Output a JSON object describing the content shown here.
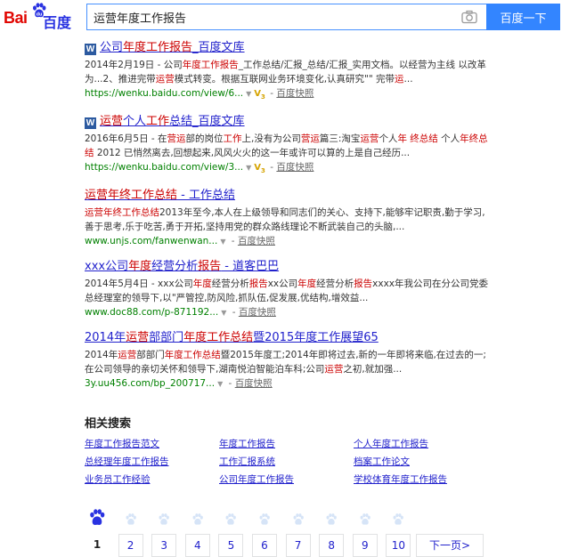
{
  "header": {
    "logo_bai": "Bai",
    "logo_du": "百度",
    "search_value": "运营年度工作报告",
    "search_button": "百度一下"
  },
  "results": [
    {
      "has_word_icon": true,
      "title_parts": [
        {
          "t": "公司",
          "hl": false
        },
        {
          "t": "年度工作报告",
          "hl": true
        },
        {
          "t": "_百度文库",
          "hl": false
        }
      ],
      "abstract_parts": [
        {
          "t": "2014年2月19日 - 公司",
          "hl": false
        },
        {
          "t": "年度工作报告",
          "hl": true
        },
        {
          "t": "_工作总结/汇报_总结/汇报_实用文档。以经营为主线 以改革为...2、推进完带",
          "hl": false
        },
        {
          "t": "运营",
          "hl": true
        },
        {
          "t": "模式转变。根据互联网业务环境变化,认真研究\"\" 完带",
          "hl": false
        },
        {
          "t": "运",
          "hl": true
        },
        {
          "t": "...",
          "hl": false
        }
      ],
      "url": "https://wenku.baidu.com/view/6...",
      "has_v3": true,
      "snapshot": "百度快照"
    },
    {
      "has_word_icon": true,
      "title_parts": [
        {
          "t": "运营",
          "hl": true
        },
        {
          "t": "个人",
          "hl": false
        },
        {
          "t": "工作",
          "hl": true
        },
        {
          "t": "总结_百度文库",
          "hl": false
        }
      ],
      "abstract_parts": [
        {
          "t": "2016年6月5日 - 在",
          "hl": false
        },
        {
          "t": "营运",
          "hl": true
        },
        {
          "t": "部的岗位",
          "hl": false
        },
        {
          "t": "工作",
          "hl": true
        },
        {
          "t": "上,没有为公司",
          "hl": false
        },
        {
          "t": "营运",
          "hl": true
        },
        {
          "t": "篇三:淘宝",
          "hl": false
        },
        {
          "t": "运营",
          "hl": true
        },
        {
          "t": "个人",
          "hl": false
        },
        {
          "t": "年 终总结",
          "hl": true
        },
        {
          "t": " 个人",
          "hl": false
        },
        {
          "t": "年终总结",
          "hl": true
        },
        {
          "t": " 2012 已悄然离去,回想起来,风风火火的这一年或许可以算的上是自己经历...",
          "hl": false
        }
      ],
      "url": "https://wenku.baidu.com/view/3...",
      "has_v3": true,
      "snapshot": "百度快照"
    },
    {
      "has_word_icon": false,
      "title_parts": [
        {
          "t": "运营年终工作总结",
          "hl": true
        },
        {
          "t": " - 工作总结",
          "hl": false
        }
      ],
      "abstract_parts": [
        {
          "t": "运营年终工作总结",
          "hl": true
        },
        {
          "t": "2013年至今,本人在上级领导和同志们的关心、支持下,能够牢记职责,勤于学习,善于思考,乐于吃苦,勇于开拓,坚持用党的群众路线理论不断武装自己的头脑,...",
          "hl": false
        }
      ],
      "url": "www.unjs.com/fanwenwan...",
      "has_v3": false,
      "snapshot": "百度快照"
    },
    {
      "has_word_icon": false,
      "title_parts": [
        {
          "t": "xxx公司",
          "hl": false
        },
        {
          "t": "年度",
          "hl": true
        },
        {
          "t": "经营分析",
          "hl": false
        },
        {
          "t": "报告",
          "hl": true
        },
        {
          "t": " - 道客巴巴",
          "hl": false
        }
      ],
      "abstract_parts": [
        {
          "t": "2014年5月4日 - xxx公司",
          "hl": false
        },
        {
          "t": "年度",
          "hl": true
        },
        {
          "t": "经营分析",
          "hl": false
        },
        {
          "t": "报告",
          "hl": true
        },
        {
          "t": "xx公司",
          "hl": false
        },
        {
          "t": "年度",
          "hl": true
        },
        {
          "t": "经营分析",
          "hl": false
        },
        {
          "t": "报告",
          "hl": true
        },
        {
          "t": "xxxx年我公司在分公司党委总经理室的领导下,以\"严管控,防风险,抓队伍,促发展,优结构,增效益...",
          "hl": false
        }
      ],
      "url": "www.doc88.com/p-871192...",
      "has_v3": false,
      "snapshot": "百度快照"
    },
    {
      "has_word_icon": false,
      "title_parts": [
        {
          "t": "2014年",
          "hl": false
        },
        {
          "t": "运营",
          "hl": true
        },
        {
          "t": "部部门",
          "hl": false
        },
        {
          "t": "年度工作总结",
          "hl": true
        },
        {
          "t": "暨2015年度工作展望65",
          "hl": false
        }
      ],
      "abstract_parts": [
        {
          "t": "2014年",
          "hl": false
        },
        {
          "t": "运营",
          "hl": true
        },
        {
          "t": "部部门",
          "hl": false
        },
        {
          "t": "年度工作总结",
          "hl": true
        },
        {
          "t": "暨2015年度工;2014年即将过去,新的一年即将来临,在过去的一;在公司领导的亲切关怀和领导下,湖南悦泊智能泊车科;公司",
          "hl": false
        },
        {
          "t": "运营",
          "hl": true
        },
        {
          "t": "之初,就加强...",
          "hl": false
        }
      ],
      "url": "3y.uu456.com/bp_200717...",
      "has_v3": false,
      "snapshot": "百度快照"
    }
  ],
  "related": {
    "title": "相关搜索",
    "links": [
      "年度工作报告范文",
      "年度工作报告",
      "个人年度工作报告",
      "总经理年度工作报告",
      "工作汇报系统",
      "档案工作论文",
      "业务员工作经验",
      "公司年度工作报告",
      "学校体育年度工作报告"
    ]
  },
  "pager": {
    "pages": [
      "1",
      "2",
      "3",
      "4",
      "5",
      "6",
      "7",
      "8",
      "9",
      "10"
    ],
    "current": "1",
    "next": "下一页>"
  },
  "colors": {
    "link": "#2121cc",
    "highlight": "#c00",
    "url": "#008000",
    "button": "#3385ff",
    "logo_red": "#e10602",
    "logo_blue": "#2932e1"
  }
}
